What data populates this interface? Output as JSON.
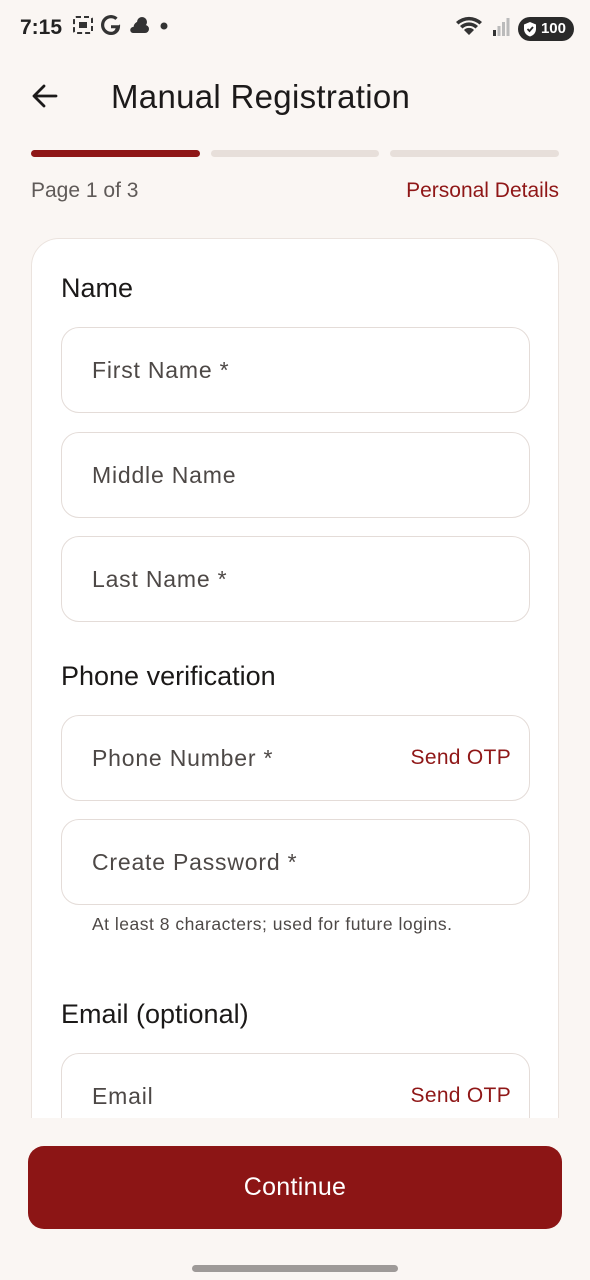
{
  "status_bar": {
    "time": "7:15",
    "left_icons": [
      "screenshot-icon",
      "google-icon",
      "weather-icon",
      "dot-icon"
    ],
    "right_icons": [
      "wifi-icon",
      "signal-icon",
      "battery-icon"
    ],
    "battery": "100",
    "wifi_badge": "6"
  },
  "app_bar": {
    "back_icon": "arrow-left-icon",
    "title": "Manual Registration"
  },
  "progress": {
    "total_steps": 3,
    "current_step": 1,
    "page_label": "Page 1 of 3",
    "step_name": "Personal Details",
    "colors": {
      "active": "#8f1717",
      "inactive": "#e7dfda"
    }
  },
  "form": {
    "name_section": {
      "title": "Name",
      "first_name_placeholder": "First Name *",
      "middle_name_placeholder": "Middle Name",
      "last_name_placeholder": "Last Name *"
    },
    "phone_section": {
      "title": "Phone verification",
      "phone_placeholder": "Phone Number *",
      "phone_action": "Send OTP",
      "password_placeholder": "Create Password *",
      "password_helper": "At least 8 characters; used for future logins."
    },
    "email_section": {
      "title": "Email (optional)",
      "email_placeholder": "Email",
      "email_action": "Send OTP"
    }
  },
  "footer": {
    "continue_label": "Continue",
    "accent_color": "#8c1515"
  }
}
